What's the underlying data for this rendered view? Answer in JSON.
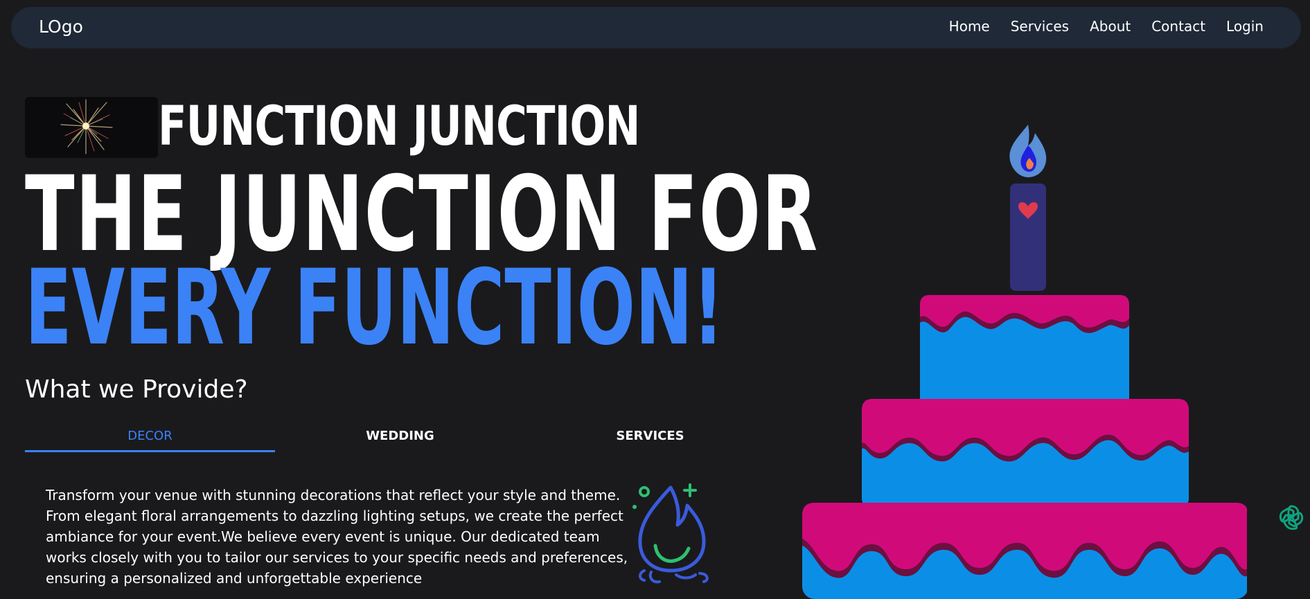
{
  "nav": {
    "logo": "LOgo",
    "links": [
      "Home",
      "Services",
      "About",
      "Contact",
      "Login"
    ]
  },
  "hero": {
    "brand": "FUNCTION JUNCTION",
    "headline_line1": "THE JUNCTION FOR",
    "headline_line2": "EVERY FUNCTION!",
    "section_heading": "What we Provide?"
  },
  "tabs": {
    "items": [
      "DECOR",
      "WEDDING",
      "SERVICES"
    ],
    "active": "DECOR"
  },
  "panel": {
    "text": "Transform your venue with stunning decorations that reflect your style and theme. From elegant floral arrangements to dazzling lighting setups, we create the perfect ambiance for your event.We believe every event is unique. Our dedicated team works closely with you to tailor our services to your specific needs and preferences, ensuring a personalized and unforgettable experience"
  },
  "icons": {
    "decor": "fire-icon",
    "candle_heart": "heart-icon",
    "assistant": "assistant-icon"
  },
  "colors": {
    "accent": "#3b82f6",
    "cake_blue": "#0b8fe6",
    "cake_icing": "#d10a7a",
    "candle": "#33307a",
    "nav_bg": "#1f2937"
  }
}
